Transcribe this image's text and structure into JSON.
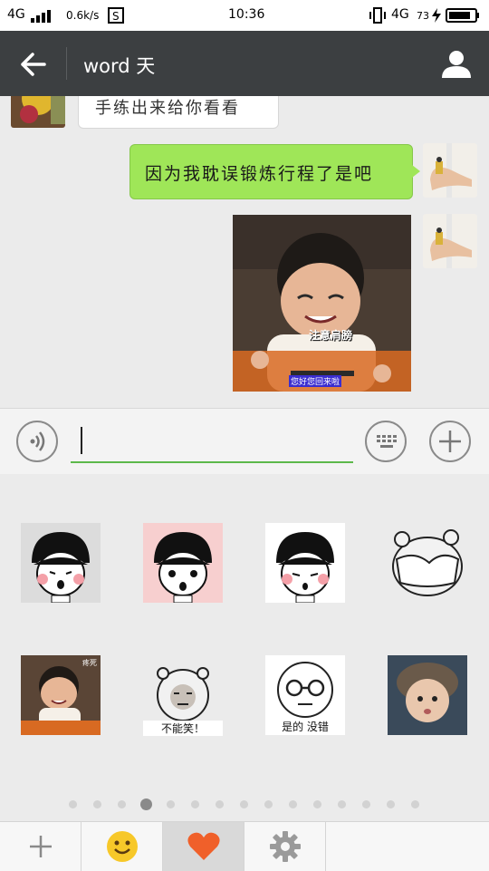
{
  "status": {
    "network_left": "4G",
    "speed": "0.6k/s",
    "time": "10:36",
    "network_right": "4G",
    "battery": "73"
  },
  "header": {
    "title": "word 天"
  },
  "messages": [
    {
      "side": "left",
      "text": "手练出来给你看看"
    },
    {
      "side": "right",
      "text": "因为我耽误锻炼行程了是吧"
    },
    {
      "side": "right",
      "photo_caption_1": "注意肩膀",
      "photo_caption_2": "您好您回来啦"
    }
  ],
  "composer": {
    "value": ""
  },
  "stickers": [
    {
      "caption": ""
    },
    {
      "caption": ""
    },
    {
      "caption": ""
    },
    {
      "caption": ""
    },
    {
      "caption": "疼死"
    },
    {
      "caption": "不能笑！"
    },
    {
      "caption": "是的 没错"
    },
    {
      "caption": ""
    }
  ],
  "pager": {
    "count": 15,
    "active": 3
  },
  "tabs": [
    "add",
    "emoji",
    "favorites",
    "settings"
  ],
  "colors": {
    "sent_bubble": "#9fe658",
    "accent": "#5cb84b",
    "header": "#3c3f41"
  }
}
